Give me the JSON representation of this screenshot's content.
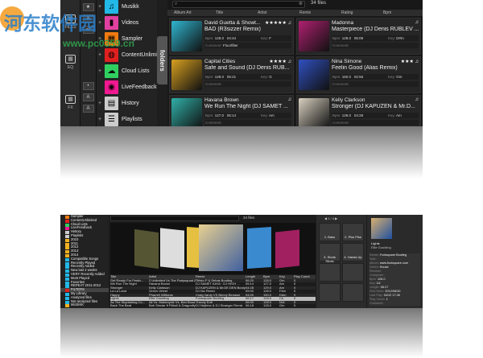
{
  "watermark": {
    "cn": "河东软件园",
    "url": "www.pc0359.cn"
  },
  "top": {
    "left_strip": [
      {
        "icon": "folder-icon",
        "label": "FILES"
      },
      {
        "icon": "equalizer-icon",
        "label": "EQ"
      },
      {
        "icon": "waveform-icon",
        "label": "FX"
      }
    ],
    "mini_buttons": [
      "★",
      "≡",
      "↩",
      "•",
      "A",
      "A"
    ],
    "folders": [
      {
        "label": "Musikk",
        "color": "#22b8e8",
        "icon": "♫"
      },
      {
        "label": "Videos",
        "color": "#e040a0",
        "icon": "▮"
      },
      {
        "label": "Sampler",
        "color": "#f07a10",
        "icon": "▦"
      },
      {
        "label": "ContentUnlimited",
        "color": "#e02020",
        "icon": "◍"
      },
      {
        "label": "Cloud Lists",
        "color": "#30d060",
        "icon": "☁"
      },
      {
        "label": "LiveFeedback",
        "color": "#f01890",
        "icon": "◉"
      },
      {
        "label": "History",
        "color": "#cccccc",
        "icon": "▤"
      },
      {
        "label": "Playlists",
        "color": "#cccccc",
        "icon": "☰"
      }
    ],
    "folders_tab": "folders",
    "search": {
      "placeholder": "",
      "clear": "⊗"
    },
    "file_count": "34 files",
    "columns": [
      "Album Art",
      "Title",
      "Artist",
      "Remix",
      "Rating",
      "Bpm"
    ],
    "labels": {
      "bpm": "Bpm:",
      "key": "Key:",
      "comment": "Comment:"
    },
    "tracks": [
      {
        "artist": "David Guetta & Showt...",
        "title": "BAD (R3sizzer Remix)",
        "bpm": "128.0",
        "time": "04:44",
        "key": "F",
        "comment": "Floorfilter",
        "rating": "★★★★★ ♫",
        "art": "#2fb6d0"
      },
      {
        "artist": "Madonna",
        "title": "Masterpiece (DJ Denis RUBLEV ...",
        "bpm": "128.0",
        "time": "05:09",
        "key": "D#m",
        "comment": "",
        "rating": "♫",
        "art": "#b02070"
      },
      {
        "artist": "Capital Cities",
        "title": "Safe and Sound (DJ Denis RUB...",
        "bpm": "128.0",
        "time": "05:21",
        "key": "G",
        "comment": "",
        "rating": "★★★★ ♫",
        "art": "#d8a020"
      },
      {
        "artist": "Nina Simone",
        "title": "Feelin Good (Alias Remix)",
        "bpm": "160.0",
        "time": "02:56",
        "key": "Gm",
        "comment": "",
        "rating": "★★★ ♫",
        "art": "#3050c0"
      },
      {
        "artist": "Havana Brown",
        "title": "We Run The Night (DJ SAMET ...",
        "bpm": "127.0",
        "time": "05:14",
        "key": "Am",
        "comment": "",
        "rating": "♫",
        "art": "#30b0a8"
      },
      {
        "artist": "Kelly Clarkson",
        "title": "Stronger (DJ KAPUZEN & Mr.D...",
        "bpm": "129.0",
        "time": "04:28",
        "key": "Am",
        "comment": "",
        "rating": "♫",
        "art": "#d8d0c0"
      }
    ]
  },
  "bottom": {
    "sidebar": [
      {
        "label": "Sampler",
        "c": "#f07a10"
      },
      {
        "label": "ContentUnlimited",
        "c": "#e02020"
      },
      {
        "label": "Cloud Lists",
        "c": "#30d060"
      },
      {
        "label": "LiveFeedback",
        "c": "#f01890"
      },
      {
        "label": "History",
        "c": "#ccc"
      },
      {
        "label": "Playlists",
        "c": "#ccc"
      },
      {
        "label": "2010",
        "c": "#f0b020"
      },
      {
        "label": "2011",
        "c": "#f0b020"
      },
      {
        "label": "2012",
        "c": "#f0b020"
      },
      {
        "label": "2013",
        "c": "#f0b020"
      },
      {
        "label": "2014",
        "c": "#f0b020"
      },
      {
        "label": "Compatible Songs",
        "c": "#22b8e8"
      },
      {
        "label": "Recently Played",
        "c": "#22b8e8"
      },
      {
        "label": "Recently Added",
        "c": "#22b8e8"
      },
      {
        "label": "New last 2 weeks",
        "c": "#22b8e8"
      },
      {
        "label": "VERY Recently Added",
        "c": "#22b8e8"
      },
      {
        "label": "Most Played",
        "c": "#22b8e8"
      },
      {
        "label": "Favorites",
        "c": "#22b8e8"
      },
      {
        "label": "REPEAT 2011-2012",
        "c": "#22b8e8"
      },
      {
        "label": "FILTERS",
        "c": "#e02020"
      },
      {
        "label": "My Library",
        "c": "#22b8e8"
      },
      {
        "label": "Analyzed files",
        "c": "#22b8e8"
      },
      {
        "label": "Not analyzed files",
        "c": "#22b8e8"
      },
      {
        "label": "MUSIKK",
        "c": "#f0b020"
      }
    ],
    "file_count": "34 files",
    "columns": [
      "Title",
      "Artist",
      "Remix",
      "Length",
      "Bpm",
      "Key",
      "Play Count"
    ],
    "rows": [
      [
        "Get Ready For Festiv...",
        "2 Unlimited Vs The Partysquad & ...",
        "Tiësto P & Sebas Bootleg",
        "06:20",
        "128.0",
        "Gm",
        "0"
      ],
      [
        "We Run The Night",
        "Havana Brown",
        "DJ SAMET KAYA · DJ HIGH ...",
        "05:14",
        "127.0",
        "Am",
        "0"
      ],
      [
        "Stronger",
        "Kelly Clarkson",
        "DJ KAPUZEN & Mr.DE DEN Booty Mix",
        "04:28",
        "129.0",
        "Am",
        "0"
      ],
      [
        "La La Land",
        "Green Velvet",
        "DJ Nic Remix",
        "05:00",
        "128.0",
        "F#m",
        "0"
      ],
      [
        "Happy",
        "Pharrell Williams",
        "Craig Vardy VS Benny Benassi",
        "04:00",
        "150.0",
        "D#m",
        "0"
      ],
      [
        "Lights",
        "Ellie Goulding",
        "Footsquare Bootleg",
        "06:17",
        "128.0",
        "C#",
        "0"
      ],
      [
        "As The Skydarking Co...",
        "Ali Vs. Motorcycle Vs. Ben Boud...",
        "Traxxly Edit",
        "06:00",
        "128.0",
        "N/A",
        "0"
      ],
      [
        "Back The Beat",
        "Bob Sinclar ft Pitbull & Dragonfly",
        "DJ Nejtrino & DJ Stranger Remix",
        "06:18",
        "128.0",
        "Gm",
        "0"
      ],
      [
        "Can't Remember to Fo...",
        "Shakira feat Rihanna",
        "Dirty Pop Deconstruction",
        "05:01",
        "128.0",
        "N/A",
        "0"
      ]
    ],
    "pads": [
      "1. Bass",
      "2. Piss Piss",
      "3. Shots Shots",
      "4. Hands Up"
    ],
    "transport": "◀ 1 / 4 ▶",
    "info": {
      "title": "Lights",
      "artist": "Ellie Goulding",
      "fields": [
        [
          "Remix:",
          "Footsquare Bootleg"
        ],
        [
          "Year:",
          ""
        ],
        [
          "Album:",
          "www.footsquare.com"
        ],
        [
          "Genre:",
          "House"
        ],
        [
          "Remixer:",
          ""
        ],
        [
          "Composer:",
          ""
        ],
        [
          "Bpm:",
          "128.0"
        ],
        [
          "Key:",
          "C#"
        ],
        [
          "Length:",
          "06:17"
        ],
        [
          "First Seen:",
          "2012/08/30"
        ],
        [
          "Last Play:",
          "04/12 17:36"
        ],
        [
          "Play Count:",
          "1"
        ],
        [
          "Comment:",
          ""
        ]
      ]
    }
  }
}
